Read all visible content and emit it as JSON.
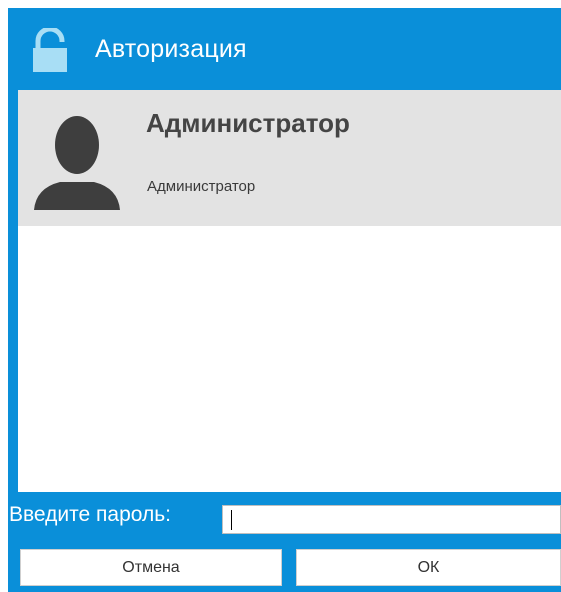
{
  "window": {
    "title": "Авторизация",
    "title_icon": "lock-icon",
    "accent_color": "#0a8fd9"
  },
  "user": {
    "name": "Администратор",
    "role": "Администратор",
    "avatar_icon": "user-silhouette-icon",
    "selected_background": "#e3e3e3"
  },
  "password": {
    "label": "Введите пароль:",
    "value": ""
  },
  "buttons": {
    "cancel": "Отмена",
    "ok": "ОК"
  }
}
